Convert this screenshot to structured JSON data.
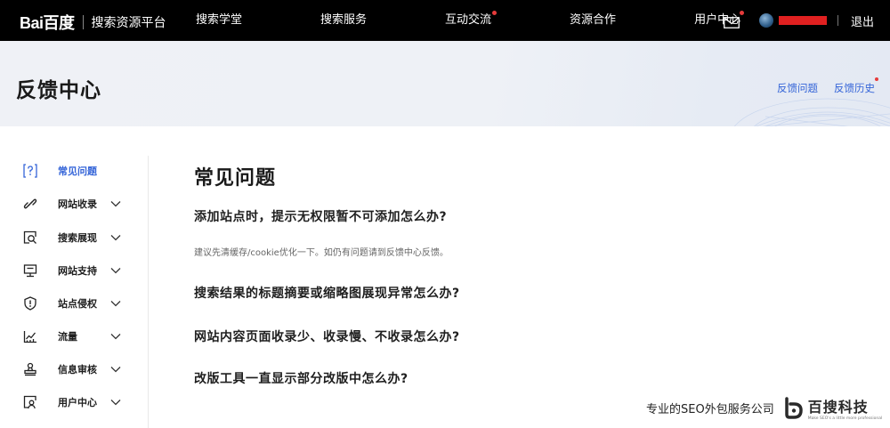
{
  "topbar": {
    "logo_text": "Bai百度",
    "platform_name": "搜索资源平台",
    "nav": [
      {
        "label": "搜索学堂",
        "dot": false
      },
      {
        "label": "搜索服务",
        "dot": false
      },
      {
        "label": "互动交流",
        "dot": true
      },
      {
        "label": "资源合作",
        "dot": false
      },
      {
        "label": "用户中心",
        "dot": false
      }
    ],
    "icons": {
      "mail": "mail-icon",
      "avatar": "avatar"
    },
    "logout": "退出",
    "notification_color": "#e63b3b"
  },
  "banner": {
    "title": "反馈中心",
    "links": [
      {
        "label": "反馈问题",
        "dot": false
      },
      {
        "label": "反馈历史",
        "dot": true
      }
    ]
  },
  "sidebar": {
    "items": [
      {
        "label": "常见问题",
        "icon": "question-icon",
        "active": true,
        "expandable": false
      },
      {
        "label": "网站收录",
        "icon": "link-icon",
        "active": false,
        "expandable": true
      },
      {
        "label": "搜索展现",
        "icon": "search-display-icon",
        "active": false,
        "expandable": true
      },
      {
        "label": "网站支持",
        "icon": "monitor-icon",
        "active": false,
        "expandable": true
      },
      {
        "label": "站点侵权",
        "icon": "shield-alert-icon",
        "active": false,
        "expandable": true
      },
      {
        "label": "流量",
        "icon": "chart-icon",
        "active": false,
        "expandable": true
      },
      {
        "label": "信息审核",
        "icon": "stamp-icon",
        "active": false,
        "expandable": true
      },
      {
        "label": "用户中心",
        "icon": "user-search-icon",
        "active": false,
        "expandable": true
      }
    ]
  },
  "main": {
    "title": "常见问题",
    "questions": [
      {
        "text": "添加站点时，提示无权限暂不可添加怎么办?",
        "answer": "建议先清缓存/cookie优化一下。如仍有问题请到反馈中心反馈。"
      },
      {
        "text": "搜索结果的标题摘要或缩略图展现异常怎么办?"
      },
      {
        "text": "网站内容页面收录少、收录慢、不收录怎么办?"
      },
      {
        "text": "改版工具一直显示部分改版中怎么办?"
      }
    ]
  },
  "watermark": {
    "text": "专业的SEO外包服务公司",
    "brand": "百搜科技",
    "tagline": "Make SEO's a little more professional"
  },
  "colors": {
    "accent": "#3565d8",
    "topbar_bg": "#000000",
    "banner_bg": "#edf0f5"
  }
}
